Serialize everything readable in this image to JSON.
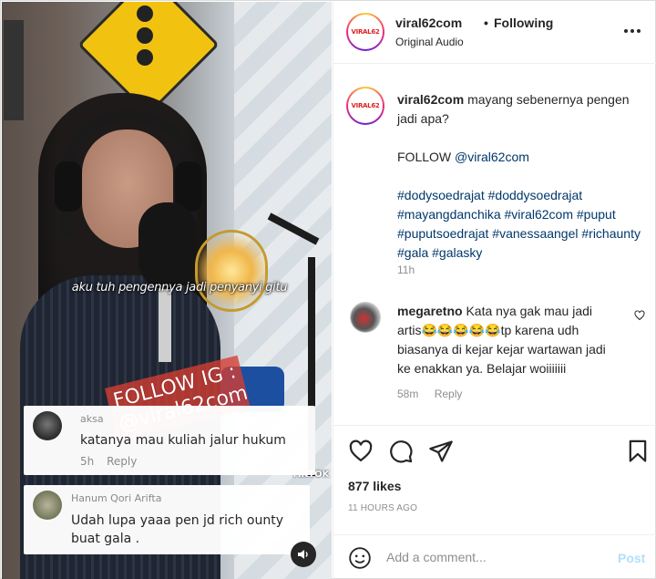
{
  "colors": {
    "link": "#00376b",
    "muted": "#8e8e8e",
    "post_disabled": "#b2dffc",
    "text": "#262626"
  },
  "video": {
    "caption": "aku tuh pengennya jadi penyanyi gitu",
    "watermark": "FOLLOW IG : @viral62com",
    "tiktok_label": "TIKTOK",
    "sound_icon": "speaker-icon",
    "overlay_comments": [
      {
        "user": "aksa",
        "text": "katanya mau kuliah jalur hukum",
        "time": "5h",
        "reply": "Reply"
      },
      {
        "user": "Hanum Qori Arifta",
        "text": "Udah lupa yaaa pen jd rich ounty buat gala ."
      }
    ]
  },
  "header": {
    "avatar_logo": "VIRAL62",
    "username": "viral62com",
    "dot": "•",
    "follow_state": "Following",
    "audio": "Original Audio",
    "more_icon": "more-options-icon"
  },
  "caption": {
    "username": "viral62com",
    "text": "mayang sebenernya pengen jadi apa?",
    "follow_prefix": "FOLLOW",
    "follow_mention": "@viral62com",
    "hashtags": "#dodysoedrajat #doddysoedrajat #mayangdanchika #viral62com #puput #puputsoedrajat #vanessaangel #richaunty #gala #galasky",
    "time": "11h"
  },
  "comment": {
    "username": "megaretno",
    "text": "Kata nya gak mau jadi artis😂😂😂😂😂tp karena udh biasanya di kejar kejar wartawan jadi ke enakkan ya. Belajar woiiiiiii",
    "time": "58m",
    "reply": "Reply"
  },
  "actions": {
    "like_icon": "heart-icon",
    "comment_icon": "comment-icon",
    "share_icon": "share-icon",
    "save_icon": "bookmark-icon",
    "likes": "877 likes",
    "ago": "11 HOURS AGO"
  },
  "add_comment": {
    "placeholder": "Add a comment...",
    "post": "Post"
  }
}
